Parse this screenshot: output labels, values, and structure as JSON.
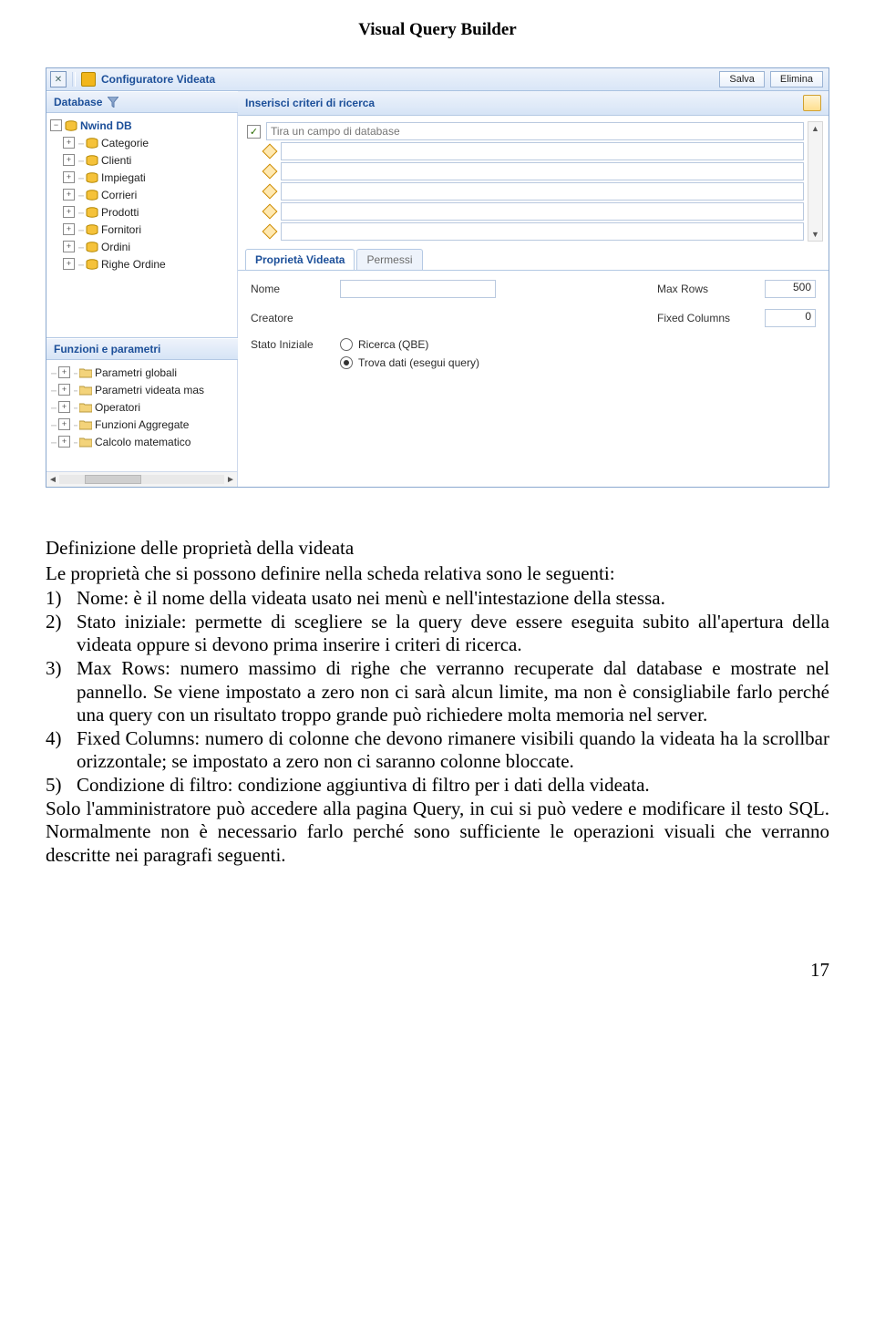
{
  "page_header": "Visual Query Builder",
  "page_number": "17",
  "titlebar": {
    "title": "Configuratore Videata",
    "save": "Salva",
    "delete": "Elimina"
  },
  "db_panel": {
    "header": "Database",
    "root": "Nwind DB",
    "tables": [
      "Categorie",
      "Clienti",
      "Impiegati",
      "Corrieri",
      "Prodotti",
      "Fornitori",
      "Ordini",
      "Righe Ordine"
    ]
  },
  "func_panel": {
    "header": "Funzioni e parametri",
    "items": [
      "Parametri globali",
      "Parametri videata mas",
      "Operatori",
      "Funzioni Aggregate",
      "Calcolo matematico"
    ]
  },
  "criteria": {
    "header": "Inserisci criteri di ricerca",
    "placeholder": "Tira un campo di database"
  },
  "tabs": {
    "tab1": "Proprietà Videata",
    "tab2": "Permessi"
  },
  "props": {
    "nome_label": "Nome",
    "nome_val": "",
    "creatore_label": "Creatore",
    "stato_label": "Stato Iniziale",
    "maxrows_label": "Max Rows",
    "maxrows_val": "500",
    "fixedcols_label": "Fixed Columns",
    "fixedcols_val": "0",
    "radio1": "Ricerca (QBE)",
    "radio2": "Trova dati (esegui query)"
  },
  "body": {
    "title": "Definizione delle proprietà della videata",
    "intro": "Le proprietà che si possono definire nella scheda relativa sono le seguenti:",
    "items": [
      "Nome: è il nome della videata usato nei menù e nell'intestazione della stessa.",
      "Stato iniziale: permette di scegliere se la query deve essere eseguita subito all'apertura della videata oppure si devono prima inserire i criteri di ricerca.",
      "Max Rows: numero massimo di righe che verranno recuperate dal database e mostrate nel pannello. Se viene impostato a zero non ci sarà alcun limite, ma non è consigliabile farlo perché una query con un risultato troppo grande può richiedere molta memoria nel server.",
      "Fixed Columns: numero di colonne che devono rimanere visibili quando la videata ha la scrollbar orizzontale; se impostato a zero non ci saranno colonne bloccate.",
      "Condizione di filtro: condizione aggiuntiva di filtro per i dati della videata."
    ],
    "outro1": "Solo l'amministratore può accedere alla pagina Query, in cui si può vedere e modificare il testo SQL. Normalmente non è necessario farlo perché sono sufficiente le operazioni visuali che verranno descritte nei paragrafi seguenti."
  }
}
